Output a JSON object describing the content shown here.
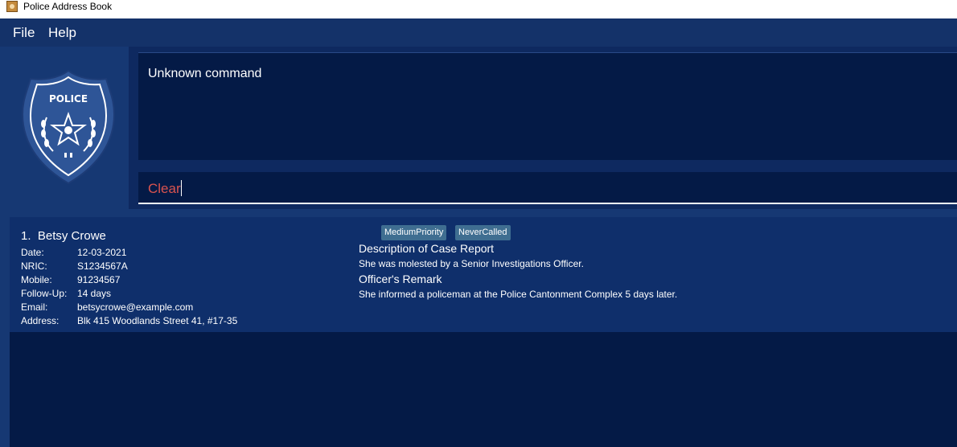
{
  "window": {
    "title": "Police Address Book"
  },
  "menu": {
    "file": "File",
    "help": "Help"
  },
  "logo": {
    "text": "POLICE"
  },
  "result": {
    "text": "Unknown command"
  },
  "command": {
    "value": "Clear"
  },
  "person": {
    "index": "1.",
    "name": "Betsy Crowe",
    "tags": [
      "MediumPriority",
      "NeverCalled"
    ],
    "fields": [
      {
        "label": "Date:",
        "value": "12-03-2021"
      },
      {
        "label": "NRIC:",
        "value": "S1234567A"
      },
      {
        "label": "Mobile:",
        "value": "91234567"
      },
      {
        "label": "Follow-Up:",
        "value": "14 days"
      },
      {
        "label": "Email:",
        "value": "betsycrowe@example.com"
      },
      {
        "label": "Address:",
        "value": "Blk 415 Woodlands Street 41, #17-35"
      }
    ],
    "description_heading": "Description of Case Report",
    "description": "She was molested by a Senior Investigations Officer.",
    "remark_heading": "Officer's Remark",
    "remark": "She informed a policeman at the Police Cantonment Complex 5 days later."
  },
  "colors": {
    "background": "#163873",
    "card": "#0f2f6b",
    "panel_dark": "#041a46",
    "tag": "#3f6e91",
    "command_text": "#d9534f"
  }
}
